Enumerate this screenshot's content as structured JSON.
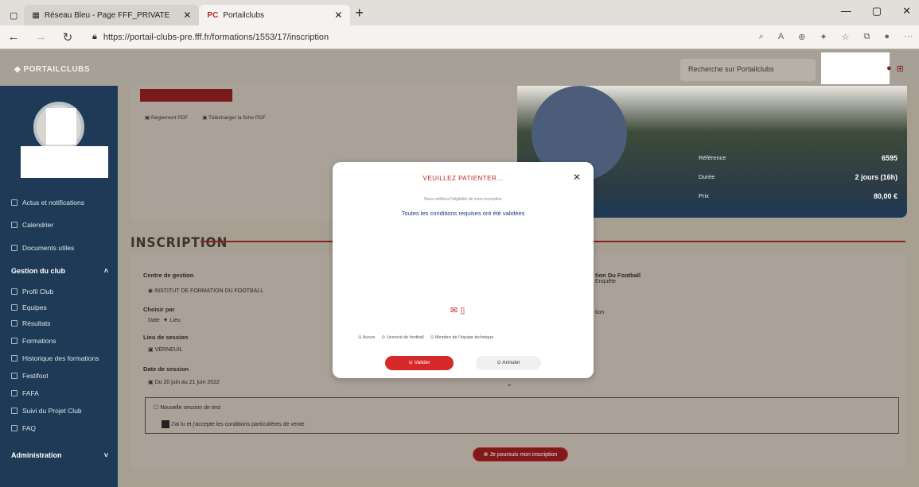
{
  "browser": {
    "tabs": [
      {
        "label": "Réseau Bleu - Page FFF_PRIVATE"
      },
      {
        "label": "Portailclubs",
        "favicon": "PC"
      }
    ],
    "new_tab_symbol": "+",
    "url": "https://portail-clubs-pre.fff.fr/formations/1553/17/inscription"
  },
  "header": {
    "logo": "PORTAILCLUBS",
    "search_placeholder": "Recherche sur Portailclubs"
  },
  "sidebar": {
    "items": [
      {
        "label": "Actus et notifications",
        "icon": "news-icon"
      },
      {
        "label": "Calendrier",
        "icon": "calendar-icon"
      },
      {
        "label": "Documents utiles",
        "icon": "documents-icon"
      },
      {
        "label": "Gestion du club",
        "icon": "chevron-up-icon",
        "section": true
      },
      {
        "label": "Profil Club",
        "icon": "profile-icon"
      },
      {
        "label": "Equipes",
        "icon": "team-icon"
      },
      {
        "label": "Résultats",
        "icon": "results-icon"
      },
      {
        "label": "Formations",
        "icon": "formations-icon"
      },
      {
        "label": "Historique des formations",
        "icon": "history-icon"
      },
      {
        "label": "Festifoot",
        "icon": "festifoot-icon"
      },
      {
        "label": "FAFA",
        "icon": "fafa-icon"
      },
      {
        "label": "Suivi du Projet Club",
        "icon": "project-icon"
      },
      {
        "label": "FAQ",
        "icon": "faq-icon"
      },
      {
        "label": "Administration",
        "icon": "chevron-down-icon",
        "section": true
      }
    ]
  },
  "topcard": {
    "pdf_rules": "Règlement PDF",
    "pdf_download": "Télécharger la fiche PDF"
  },
  "stats": [
    {
      "label": "Référence",
      "value": "6595"
    },
    {
      "label": "Durée",
      "value": "2 jours (16h)"
    },
    {
      "label": "Prix",
      "value": "80,00 €"
    }
  ],
  "inscription": {
    "title": "INSCRIPTION",
    "centre_label": "Centre de gestion",
    "centre_value": "INSTITUT DE FORMATION DU FOOTBALL",
    "choose_label": "Choisir par",
    "choose_value": "Date",
    "choose_alt": "Lieu",
    "place_label": "Lieu de session",
    "place_value": "VERNEUIL",
    "date_label": "Date de session",
    "date_value": "Du 20 juin au 21 juin 2022",
    "right_line1": "tion Du Football",
    "right_line2": "Enquête",
    "right_line3": "tion",
    "check1": "Nouvelle session de test",
    "check2": "J'ai lu et j'accepte les conditions particulières de vente",
    "submit": "Je poursuis mon inscription"
  },
  "modal": {
    "title": "VEUILLEZ PATIENTER...",
    "subtitle": "Nous vérifions l'éligibilité de votre inscription",
    "message": "Toutes les conditions requises ont été validées",
    "radios": [
      "Aucun",
      "Licencié de football",
      "Membre de l'équipe technique"
    ],
    "validate": "Valider",
    "cancel": "Annuler"
  }
}
